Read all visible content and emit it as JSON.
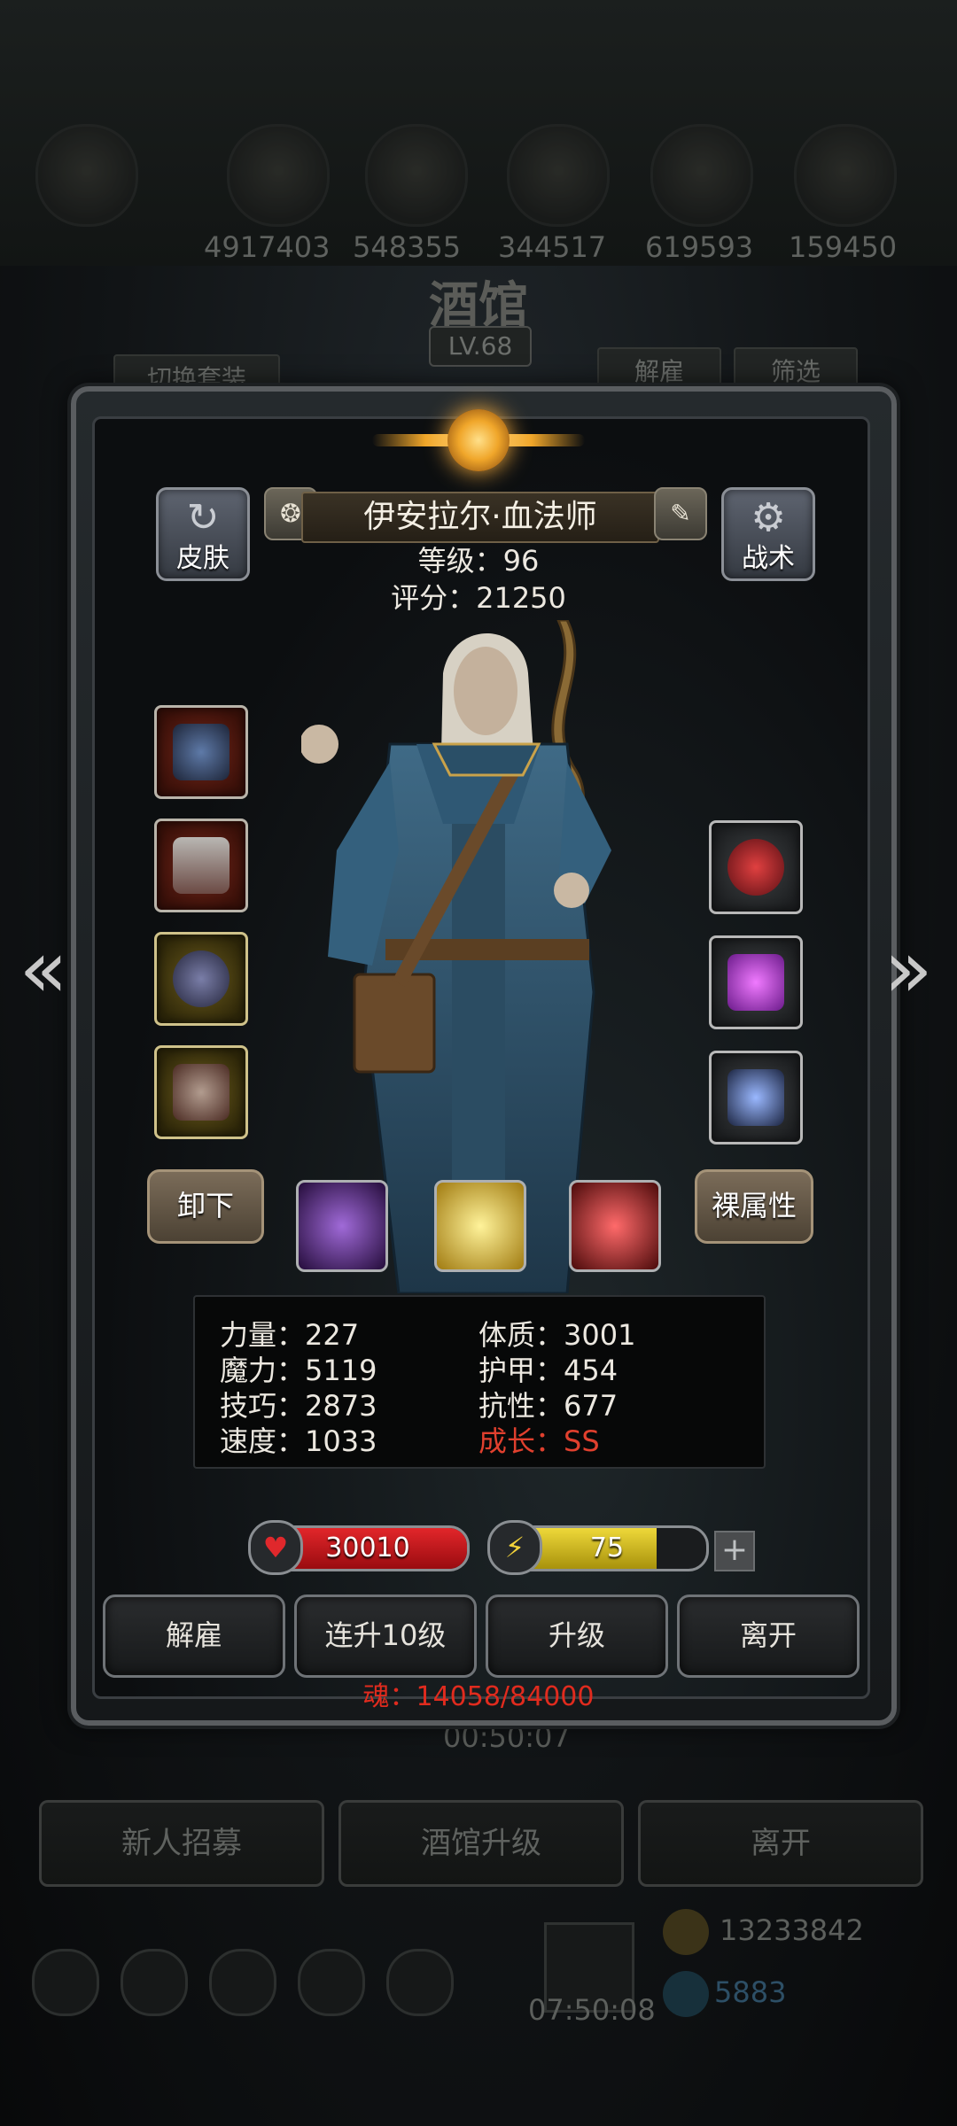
{
  "background": {
    "resources": [
      "4917403",
      "548355",
      "344517",
      "619593",
      "159450"
    ],
    "title": "酒馆",
    "level": "LV.68",
    "switch_outfit": "切换套装",
    "dismiss": "解雇",
    "filter": "筛选",
    "timer_upper": "00:50:07",
    "bottom_buttons": [
      "新人招募",
      "酒馆升级",
      "离开"
    ],
    "timer_lower": "07:50:08",
    "gold": "13233842",
    "gems": "5883"
  },
  "hero": {
    "name": "伊安拉尔·血法师",
    "level_label": "等级：96",
    "score_label": "评分：21250"
  },
  "side_buttons": {
    "skin": "皮肤",
    "tactics": "战术"
  },
  "actions": {
    "unequip": "卸下",
    "bare_attributes": "裸属性"
  },
  "attributes": {
    "strength": "力量：227",
    "magic": "魔力：5119",
    "skill": "技巧：2873",
    "speed": "速度：1033",
    "constitution": "体质：3001",
    "armor": "护甲：454",
    "resistance": "抗性：677",
    "growth": "成长：SS"
  },
  "bars": {
    "hp": "30010",
    "hp_fraction": 1.0,
    "energy": "75",
    "energy_fraction": 0.75
  },
  "buttons": {
    "dismiss": "解雇",
    "level_up_10": "连升10级",
    "level_up": "升级",
    "leave": "离开"
  },
  "soul": "魂：14058/84000",
  "colors": {
    "hp_red": "#c8141a",
    "energy_yellow": "#d8c21a",
    "growth_red": "#e0402e",
    "soul_red": "#e02b1e"
  },
  "icons": [
    "skin-shirt-icon",
    "tactics-gear-icon",
    "badge-icon",
    "edit-icon",
    "heart-icon",
    "lightning-icon",
    "plus-icon",
    "arrow-left-icon",
    "arrow-right-icon"
  ]
}
